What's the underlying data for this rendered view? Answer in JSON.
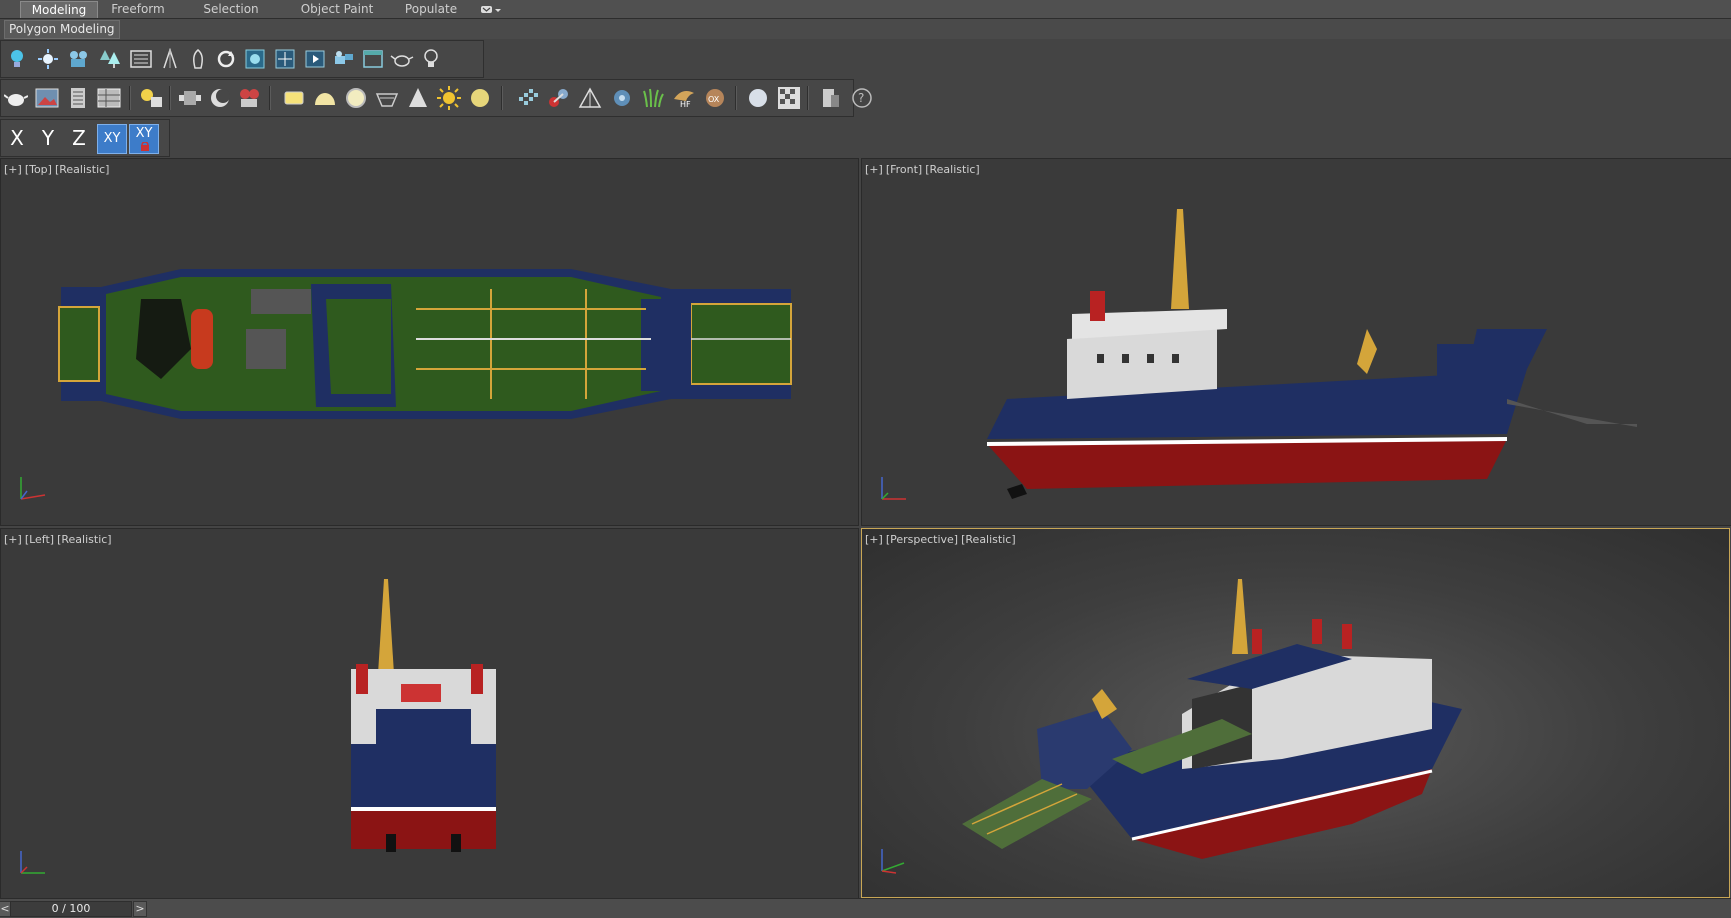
{
  "ribbon": {
    "tabs": [
      {
        "label": "Modeling",
        "active": true
      },
      {
        "label": "Freeform",
        "active": false
      },
      {
        "label": "Selection",
        "active": false
      },
      {
        "label": "Object Paint",
        "active": false
      },
      {
        "label": "Populate",
        "active": false
      }
    ],
    "subtab": "Polygon Modeling"
  },
  "toolbar1": {
    "icons": [
      "light-bulb-icon",
      "sun-burst-icon",
      "camera-icon",
      "tree-icon",
      "list-icon",
      "sort-icon",
      "lock-icon",
      "cycle-icon",
      "display-icon",
      "render-frame-icon",
      "film-icon",
      "camera-group-icon",
      "window-icon",
      "teapot-icon",
      "bulb-outline-icon"
    ]
  },
  "toolbar2": {
    "icons": [
      "teapot-render-icon",
      "image-icon",
      "layers-icon",
      "grid-icon",
      "light-list-icon",
      "particle-icon",
      "moon-icon",
      "render-camera-icon",
      "plane-icon",
      "dome-icon",
      "sphere-light-icon",
      "bowl-icon",
      "cone-icon",
      "sun-icon",
      "disc-icon",
      "mesh-icon",
      "molecule-icon",
      "pyramid-icon",
      "gear-icon",
      "grass-icon",
      "hf-icon",
      "ox-icon",
      "ball-icon",
      "checker-icon",
      "clipboard-icon",
      "help-icon"
    ],
    "labels": {
      "hf": "HF",
      "ox": "OX",
      "help": "?"
    }
  },
  "axis_toolbar": {
    "x": "X",
    "y": "Y",
    "z": "Z",
    "xy": "XY",
    "xy_lock": "XY"
  },
  "viewports": {
    "top": {
      "plus": "[+]",
      "view": "[Top]",
      "shading": "[Realistic]"
    },
    "front": {
      "plus": "[+]",
      "view": "[Front]",
      "shading": "[Realistic]"
    },
    "left": {
      "plus": "[+]",
      "view": "[Left]",
      "shading": "[Realistic]"
    },
    "persp": {
      "plus": "[+]",
      "view": "[Perspective]",
      "shading": "[Realistic]"
    }
  },
  "timeline": {
    "frame": "0 / 100",
    "prev": "<",
    "next": ">"
  },
  "colors": {
    "hull_blue": "#1f2f63",
    "hull_red": "#8b1414",
    "deck_green": "#2f5a1e",
    "superstructure": "#d9d9d9",
    "mast_yellow": "#d4a53a",
    "active_border": "#c8a655",
    "axis_active": "#3d7cc9"
  }
}
